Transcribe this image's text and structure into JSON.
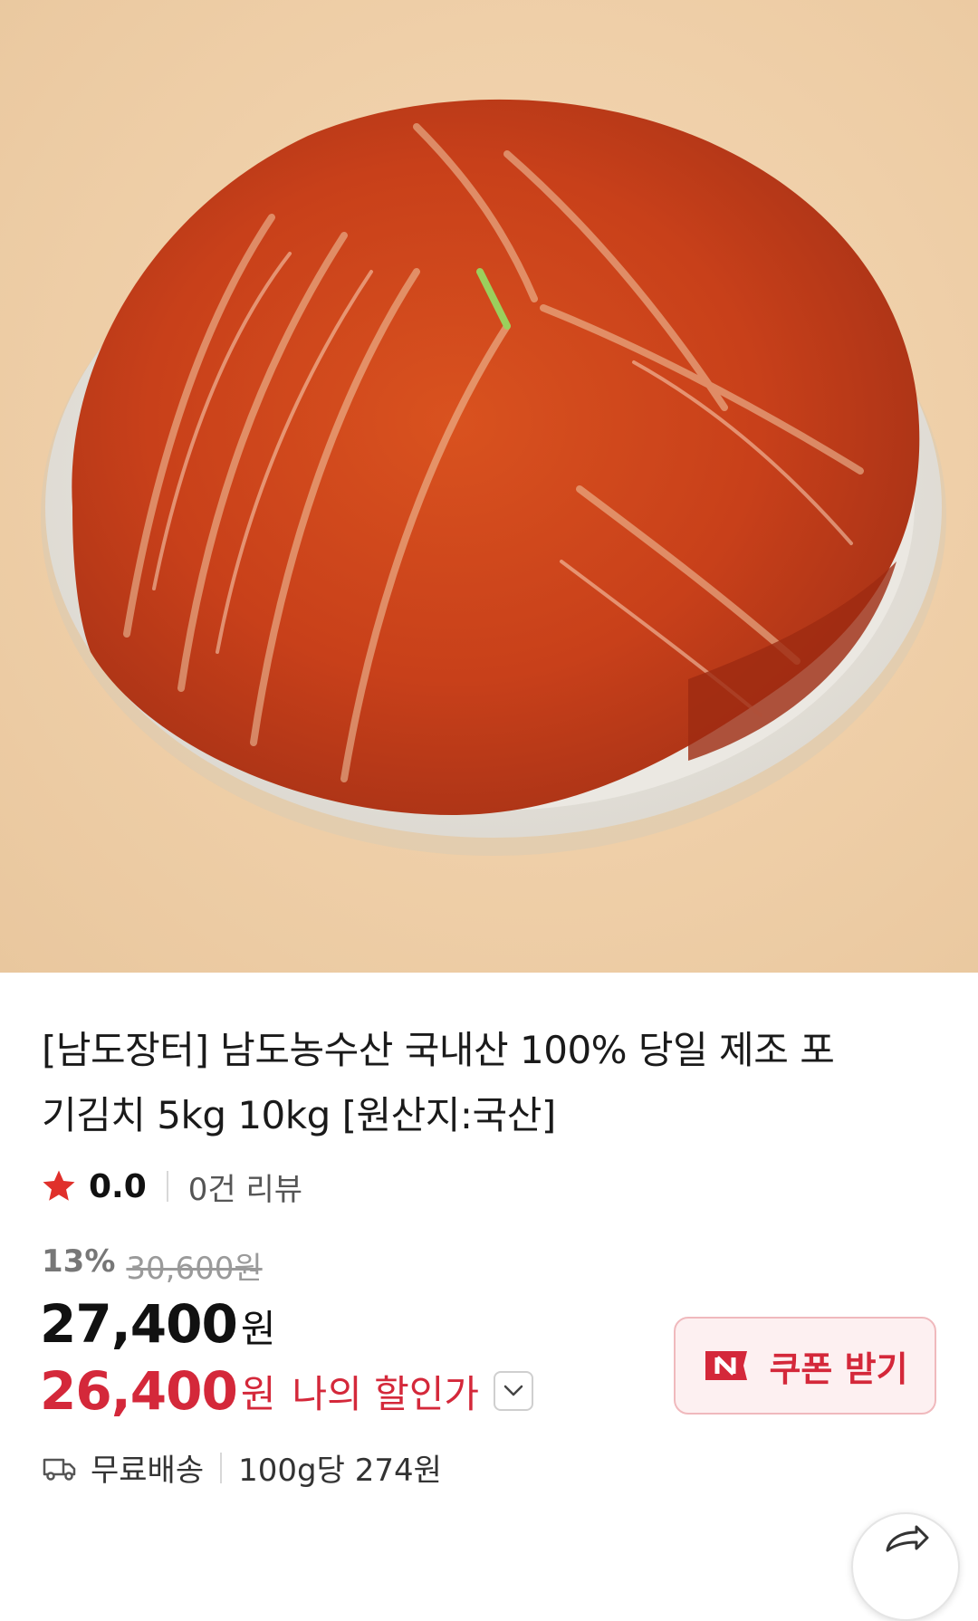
{
  "product": {
    "image_alt": "포기김치",
    "title": "[남도장터] 남도농수산 국내산 100% 당일 제조 포기김치 5kg 10kg [원산지:국산]"
  },
  "rating": {
    "score": "0.0",
    "reviews": "0건 리뷰"
  },
  "pricing": {
    "discount_pct": "13%",
    "original_price": "30,600원",
    "sale_price": "27,400",
    "sale_unit": "원",
    "my_price": "26,400",
    "my_price_unit": "원",
    "my_price_label": "나의 할인가"
  },
  "coupon": {
    "label": "쿠폰 받기",
    "badge_letter": "N"
  },
  "shipping": {
    "method": "무료배송",
    "unit_price": "100g당 274원"
  },
  "colors": {
    "accent_red": "#d4283a",
    "background": "#efcfa8",
    "coupon_bg": "#fdf0f1"
  },
  "icons": [
    "star-icon",
    "chevron-down-icon",
    "naver-n-icon",
    "truck-icon",
    "share-icon"
  ]
}
